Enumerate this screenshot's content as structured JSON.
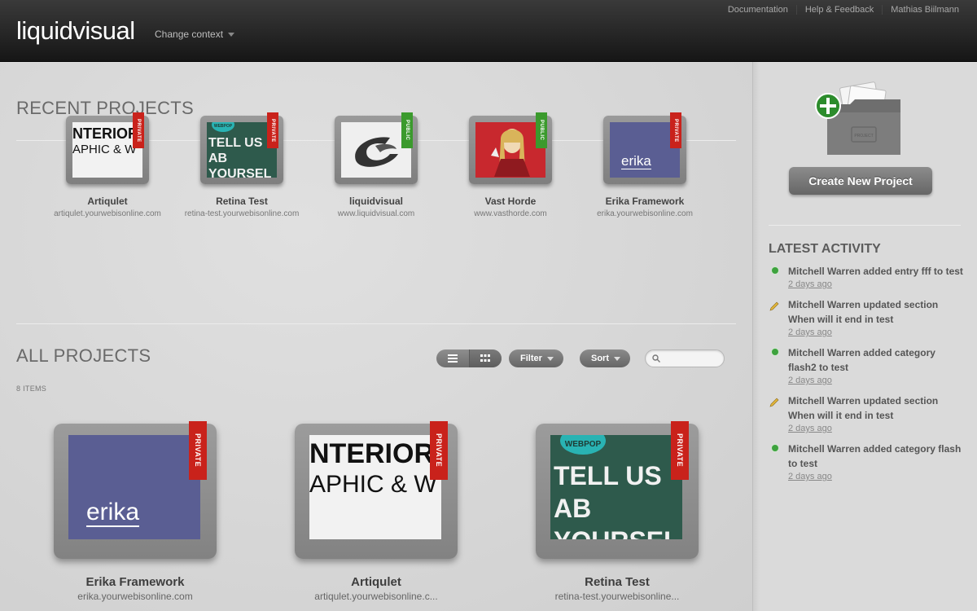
{
  "header": {
    "logo": "liquidvisual",
    "context": "Change context",
    "links": [
      "Documentation",
      "Help & Feedback",
      "Mathias Biilmann"
    ]
  },
  "recent": {
    "title": "RECENT PROJECTS",
    "items": [
      {
        "name": "Artiqulet",
        "url": "artiqulet.yourwebisonline.com",
        "badge": "PRIVATE"
      },
      {
        "name": "Retina Test",
        "url": "retina-test.yourwebisonline.com",
        "badge": "PRIVATE"
      },
      {
        "name": "liquidvisual",
        "url": "www.liquidvisual.com",
        "badge": "PUBLIC"
      },
      {
        "name": "Vast Horde",
        "url": "www.vasthorde.com",
        "badge": "PUBLIC"
      },
      {
        "name": "Erika Framework",
        "url": "erika.yourwebisonline.com",
        "badge": "PRIVATE"
      }
    ]
  },
  "thumbs": {
    "interior_l1": "NTERIOR",
    "interior_l2": "APHIC & W",
    "webpop_bubble": "WEBPOP",
    "webpop_l1": "TELL US AB",
    "webpop_l2": "YOURSEL",
    "erika": "erika"
  },
  "all": {
    "title": "ALL PROJECTS",
    "count": "8 ITEMS",
    "filter": "Filter",
    "sort": "Sort",
    "search_placeholder": "",
    "items": [
      {
        "name": "Erika Framework",
        "url": "erika.yourwebisonline.com",
        "badge": "PRIVATE"
      },
      {
        "name": "Artiqulet",
        "url": "artiqulet.yourwebisonline.c...",
        "badge": "PRIVATE"
      },
      {
        "name": "Retina Test",
        "url": "retina-test.yourwebisonline...",
        "badge": "PRIVATE"
      }
    ]
  },
  "sidebar": {
    "create_label": "Create New Project",
    "icon_label": "PROJECT",
    "activity_title": "LATEST ACTIVITY",
    "activity": [
      {
        "icon": "add-dot-icon",
        "text": "Mitchell Warren added entry fff to test",
        "time": "2 days ago"
      },
      {
        "icon": "pencil-icon",
        "text": "Mitchell Warren updated section When will it end in test",
        "time": "2 days ago"
      },
      {
        "icon": "add-dot-icon",
        "text": "Mitchell Warren added category flash2 to test",
        "time": "2 days ago"
      },
      {
        "icon": "pencil-icon",
        "text": "Mitchell Warren updated section When will it end in test",
        "time": "2 days ago"
      },
      {
        "icon": "add-dot-icon",
        "text": "Mitchell Warren added category flash to test",
        "time": "2 days ago"
      }
    ]
  },
  "colors": {
    "private": "#c9221b",
    "public": "#3b9a2d",
    "header": "#1e1e1e"
  }
}
